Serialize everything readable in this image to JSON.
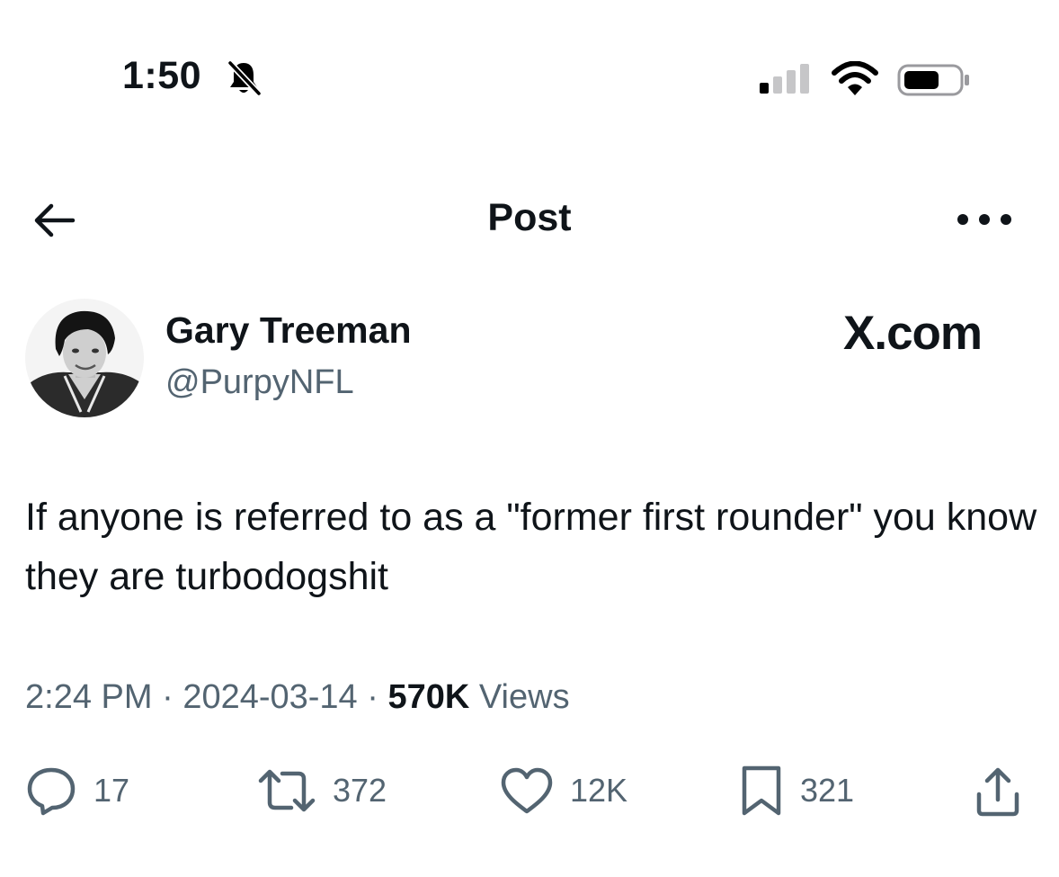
{
  "status_bar": {
    "time": "1:50"
  },
  "header": {
    "title": "Post"
  },
  "author": {
    "display_name": "Gary Treeman",
    "handle": "@PurpyNFL"
  },
  "watermark": "X.com",
  "post": {
    "text": "If anyone is referred to as a \"former first rounder\" you know they are turbodogshit",
    "time": "2:24 PM",
    "separator": "·",
    "date": "2024-03-14",
    "views_count": "570K",
    "views_label": "Views"
  },
  "actions": {
    "replies": "17",
    "reposts": "372",
    "likes": "12K",
    "bookmarks": "321"
  },
  "colors": {
    "text": "#0f1419",
    "secondary": "#536471",
    "background": "#ffffff"
  }
}
